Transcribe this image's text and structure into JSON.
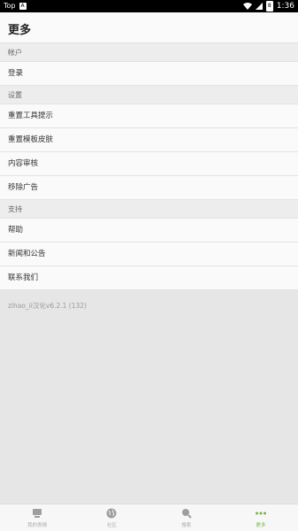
{
  "status": {
    "left_label": "Top",
    "time": "1:36"
  },
  "appbar": {
    "title": "更多"
  },
  "sections": [
    {
      "title": "帐户",
      "items": [
        "登录"
      ]
    },
    {
      "title": "设置",
      "items": [
        "重置工具提示",
        "重置模板皮肤",
        "内容审核",
        "移除广告"
      ]
    },
    {
      "title": "支持",
      "items": [
        "帮助",
        "新闻和公告",
        "联系我们"
      ]
    }
  ],
  "version_text": "zihao_ii汉化v6.2.1 (132)",
  "nav": {
    "tabs": [
      {
        "label": "我的表情",
        "icon": "meme-icon"
      },
      {
        "label": "社区",
        "icon": "globe-icon"
      },
      {
        "label": "搜索",
        "icon": "search-icon"
      },
      {
        "label": "更多",
        "icon": "more-icon"
      }
    ],
    "active_color": "#7cb342"
  }
}
